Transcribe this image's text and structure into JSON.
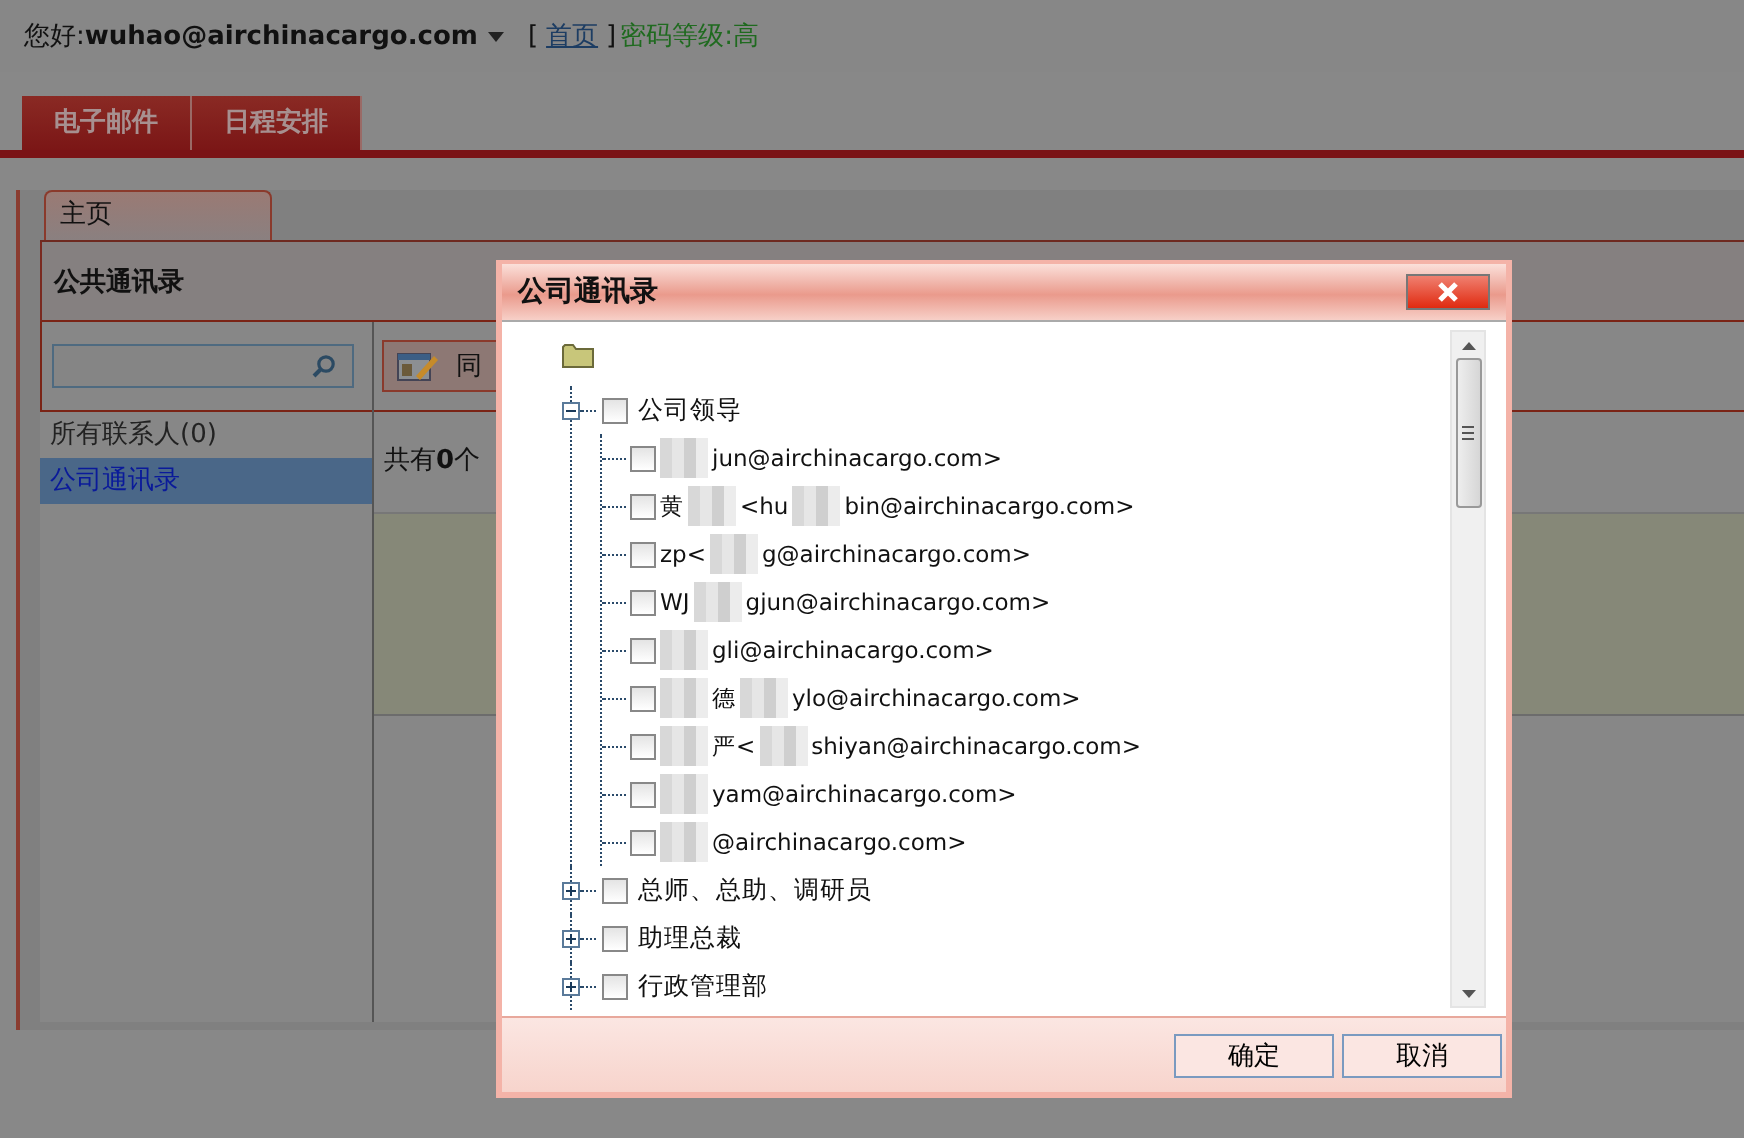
{
  "header": {
    "greeting": "您好:",
    "user": "wuhao@airchinacargo.com",
    "bracket_open": "[",
    "home_link": "首页",
    "bracket_close": "]",
    "password_level": "密码等级:高"
  },
  "nav_tabs": [
    {
      "label": "电子邮件",
      "selected": false
    },
    {
      "label": "日程安排",
      "selected": false
    }
  ],
  "page_tab": {
    "label": "主页",
    "selected": true
  },
  "panel_title": "公共通讯录",
  "sidebar": {
    "items": [
      {
        "label": "所有联系人(0)",
        "selected": false
      },
      {
        "label": "公司通讯录",
        "selected": true
      }
    ]
  },
  "toolbar": {
    "sync_button": "同"
  },
  "count_text": "共有**0**个",
  "dialog": {
    "title": "公司通讯录",
    "tree": [
      {
        "label": "公司领导",
        "expanded": true,
        "checked": false,
        "children": [
          {
            "lead_hidden": true,
            "checked": false,
            "fragments": [
              "jun@airchinacargo.com>"
            ]
          },
          {
            "lead_hidden": false,
            "checked": false,
            "fragments": [
              "黄",
              "<hu",
              "bin@airchinacargo.com>"
            ]
          },
          {
            "lead_hidden": false,
            "checked": false,
            "fragments": [
              "zp<",
              "g@airchinacargo.com>"
            ]
          },
          {
            "lead_hidden": false,
            "checked": false,
            "fragments": [
              "WJ",
              "gjun@airchinacargo.com>"
            ]
          },
          {
            "lead_hidden": true,
            "checked": false,
            "fragments": [
              "gli@airchinacargo.com>"
            ]
          },
          {
            "lead_hidden": true,
            "checked": false,
            "fragments": [
              "德",
              "ylo@airchinacargo.com>"
            ]
          },
          {
            "lead_hidden": true,
            "checked": false,
            "fragments": [
              "严<",
              "shiyan@airchinacargo.com>"
            ]
          },
          {
            "lead_hidden": true,
            "checked": false,
            "fragments": [
              "yam@airchinacargo.com>"
            ]
          },
          {
            "lead_hidden": true,
            "checked": false,
            "fragments": [
              "@airchinacargo.com>"
            ]
          }
        ]
      },
      {
        "label": "总师、总助、调研员",
        "expanded": false,
        "checked": false
      },
      {
        "label": "助理总裁",
        "expanded": false,
        "checked": false
      },
      {
        "label": "行政管理部",
        "expanded": false,
        "checked": false
      }
    ],
    "buttons": [
      "确定",
      "取消"
    ]
  }
}
